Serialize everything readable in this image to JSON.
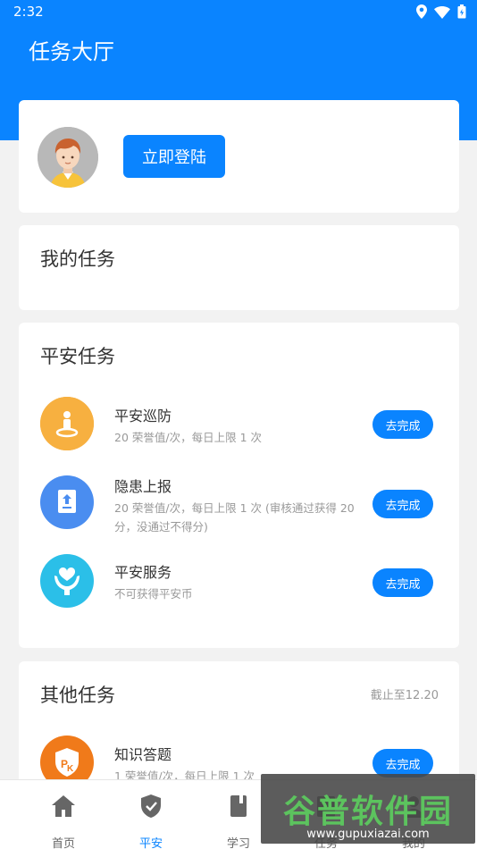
{
  "status_bar": {
    "time": "2:32"
  },
  "header": {
    "title": "任务大厅"
  },
  "login": {
    "button_label": "立即登陆"
  },
  "my_tasks": {
    "title": "我的任务"
  },
  "safe_tasks": {
    "title": "平安任务",
    "items": [
      {
        "name": "平安巡防",
        "desc": "20 荣誉值/次，每日上限 1 次",
        "button": "去完成",
        "icon": "patrol-icon",
        "color": "#f5a623"
      },
      {
        "name": "隐患上报",
        "desc": "20 荣誉值/次，每日上限 1 次 (审核通过获得 20 分，没通过不得分)",
        "button": "去完成",
        "icon": "upload-report-icon",
        "color": "#4a8df0"
      },
      {
        "name": "平安服务",
        "desc": "不可获得平安币",
        "button": "去完成",
        "icon": "heart-hands-icon",
        "color": "#2bbfe8"
      }
    ]
  },
  "other_tasks": {
    "title": "其他任务",
    "deadline": "截止至12.20",
    "items": [
      {
        "name": "知识答题",
        "desc": "1 荣誉值/次，每日上限 1 次",
        "button": "去完成",
        "icon": "pk-badge-icon",
        "color": "#f07a1a"
      }
    ]
  },
  "tab_bar": {
    "tabs": [
      {
        "label": "首页",
        "icon": "home-icon"
      },
      {
        "label": "平安",
        "icon": "shield-icon",
        "active": true
      },
      {
        "label": "学习",
        "icon": "book-icon"
      },
      {
        "label": "任务",
        "icon": "task-icon"
      },
      {
        "label": "我的",
        "icon": "user-icon"
      }
    ]
  },
  "watermark": {
    "main": "谷普软件园",
    "url": "www.gupuxiazai.com"
  },
  "colors": {
    "primary": "#0a84ff"
  }
}
